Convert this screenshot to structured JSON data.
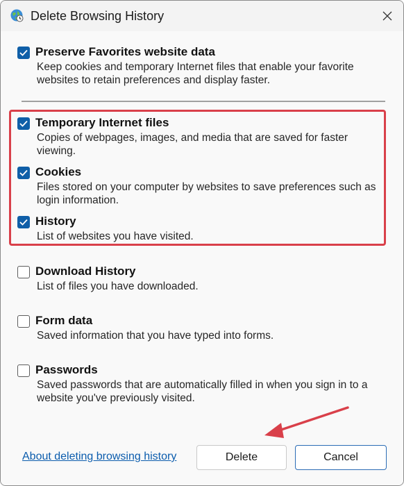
{
  "window": {
    "title": "Delete Browsing History",
    "icon": "globe-history-icon",
    "close_icon": "close-icon"
  },
  "options": [
    {
      "id": "preserve-favorites",
      "label": "Preserve Favorites website data",
      "description": "Keep cookies and temporary Internet files that enable your favorite websites to retain preferences and display faster.",
      "checked": true
    },
    {
      "id": "temporary-internet-files",
      "label": "Temporary Internet files",
      "description": "Copies of webpages, images, and media that are saved for faster viewing.",
      "checked": true
    },
    {
      "id": "cookies",
      "label": "Cookies",
      "description": "Files stored on your computer by websites to save preferences such as login information.",
      "checked": true
    },
    {
      "id": "history",
      "label": "History",
      "description": "List of websites you have visited.",
      "checked": true
    },
    {
      "id": "download-history",
      "label": "Download History",
      "description": "List of files you have downloaded.",
      "checked": false
    },
    {
      "id": "form-data",
      "label": "Form data",
      "description": "Saved information that you have typed into forms.",
      "checked": false
    },
    {
      "id": "passwords",
      "label": "Passwords",
      "description": "Saved passwords that are automatically filled in when you sign in to a website you've previously visited.",
      "checked": false
    }
  ],
  "footer": {
    "help_link": "About deleting browsing history",
    "delete_label": "Delete",
    "cancel_label": "Cancel"
  },
  "colors": {
    "accent": "#0f5fa8",
    "highlight_box": "#d9404a",
    "link": "#0b5cad"
  }
}
